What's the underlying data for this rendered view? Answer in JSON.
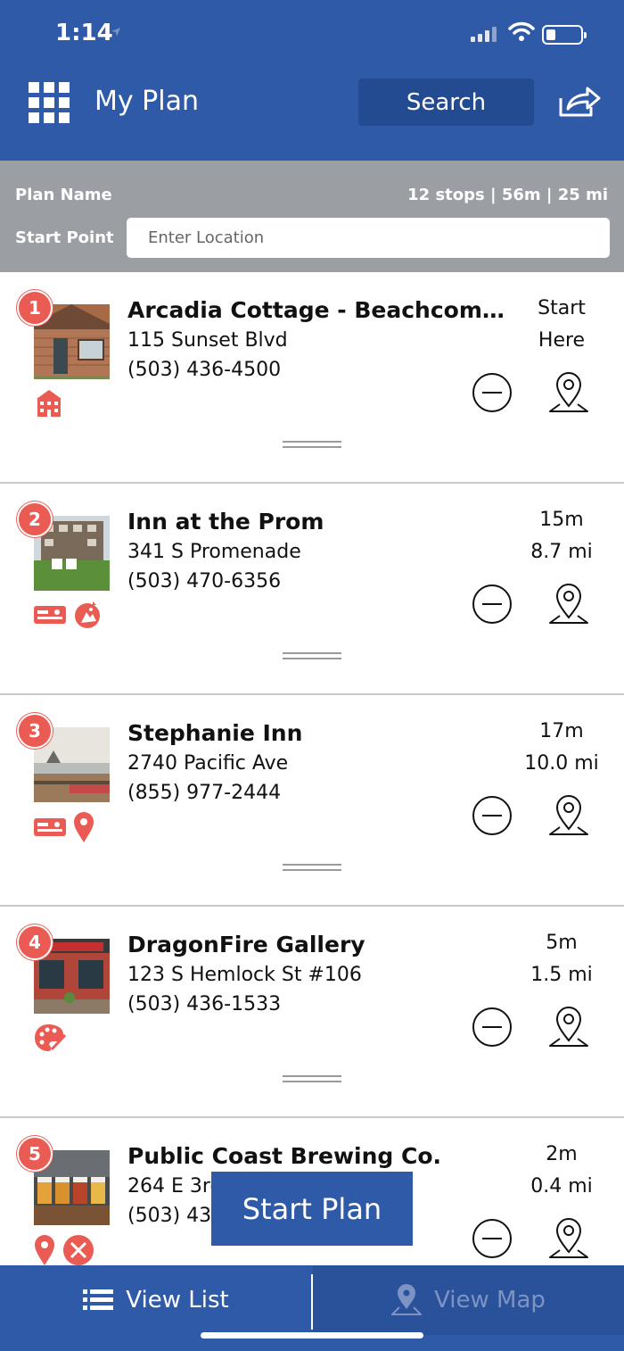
{
  "status": {
    "time": "1:14"
  },
  "header": {
    "title": "My Plan",
    "search_label": "Search"
  },
  "plan": {
    "name_label": "Plan Name",
    "stats": "12 stops | 56m | 25 mi",
    "start_label": "Start Point",
    "start_placeholder": "Enter Location"
  },
  "stops": [
    {
      "number": "1",
      "name": "Arcadia Cottage - Beachcomber…",
      "address": "115 Sunset Blvd",
      "phone": "(503) 436-4500",
      "metric1": "Start",
      "metric2": "Here",
      "categories": [
        "lodging-icon"
      ]
    },
    {
      "number": "2",
      "name": "Inn at the Prom",
      "address": "341 S Promenade",
      "phone": "(503) 470-6356",
      "metric1": "15m",
      "metric2": "8.7 mi",
      "categories": [
        "hotel-key-icon",
        "attraction-icon"
      ]
    },
    {
      "number": "3",
      "name": "Stephanie Inn",
      "address": "2740 Pacific Ave",
      "phone": "(855) 977-2444",
      "metric1": "17m",
      "metric2": "10.0 mi",
      "categories": [
        "hotel-key-icon",
        "location-pin-icon"
      ]
    },
    {
      "number": "4",
      "name": "DragonFire Gallery",
      "address": "123 S Hemlock St #106",
      "phone": "(503) 436-1533",
      "metric1": "5m",
      "metric2": "1.5 mi",
      "categories": [
        "art-palette-icon"
      ]
    },
    {
      "number": "5",
      "name": "Public Coast Brewing Co.",
      "address": "264 E 3rd",
      "phone": "(503) 436",
      "metric1": "2m",
      "metric2": "0.4 mi",
      "categories": [
        "location-pin-icon",
        "dining-icon"
      ]
    }
  ],
  "start_plan_label": "Start Plan",
  "nav": {
    "list_label": "View List",
    "map_label": "View Map"
  },
  "colors": {
    "brand_blue": "#2f5aa8",
    "accent_red": "#ea5b54",
    "plan_bar_gray": "#9b9fa3"
  }
}
